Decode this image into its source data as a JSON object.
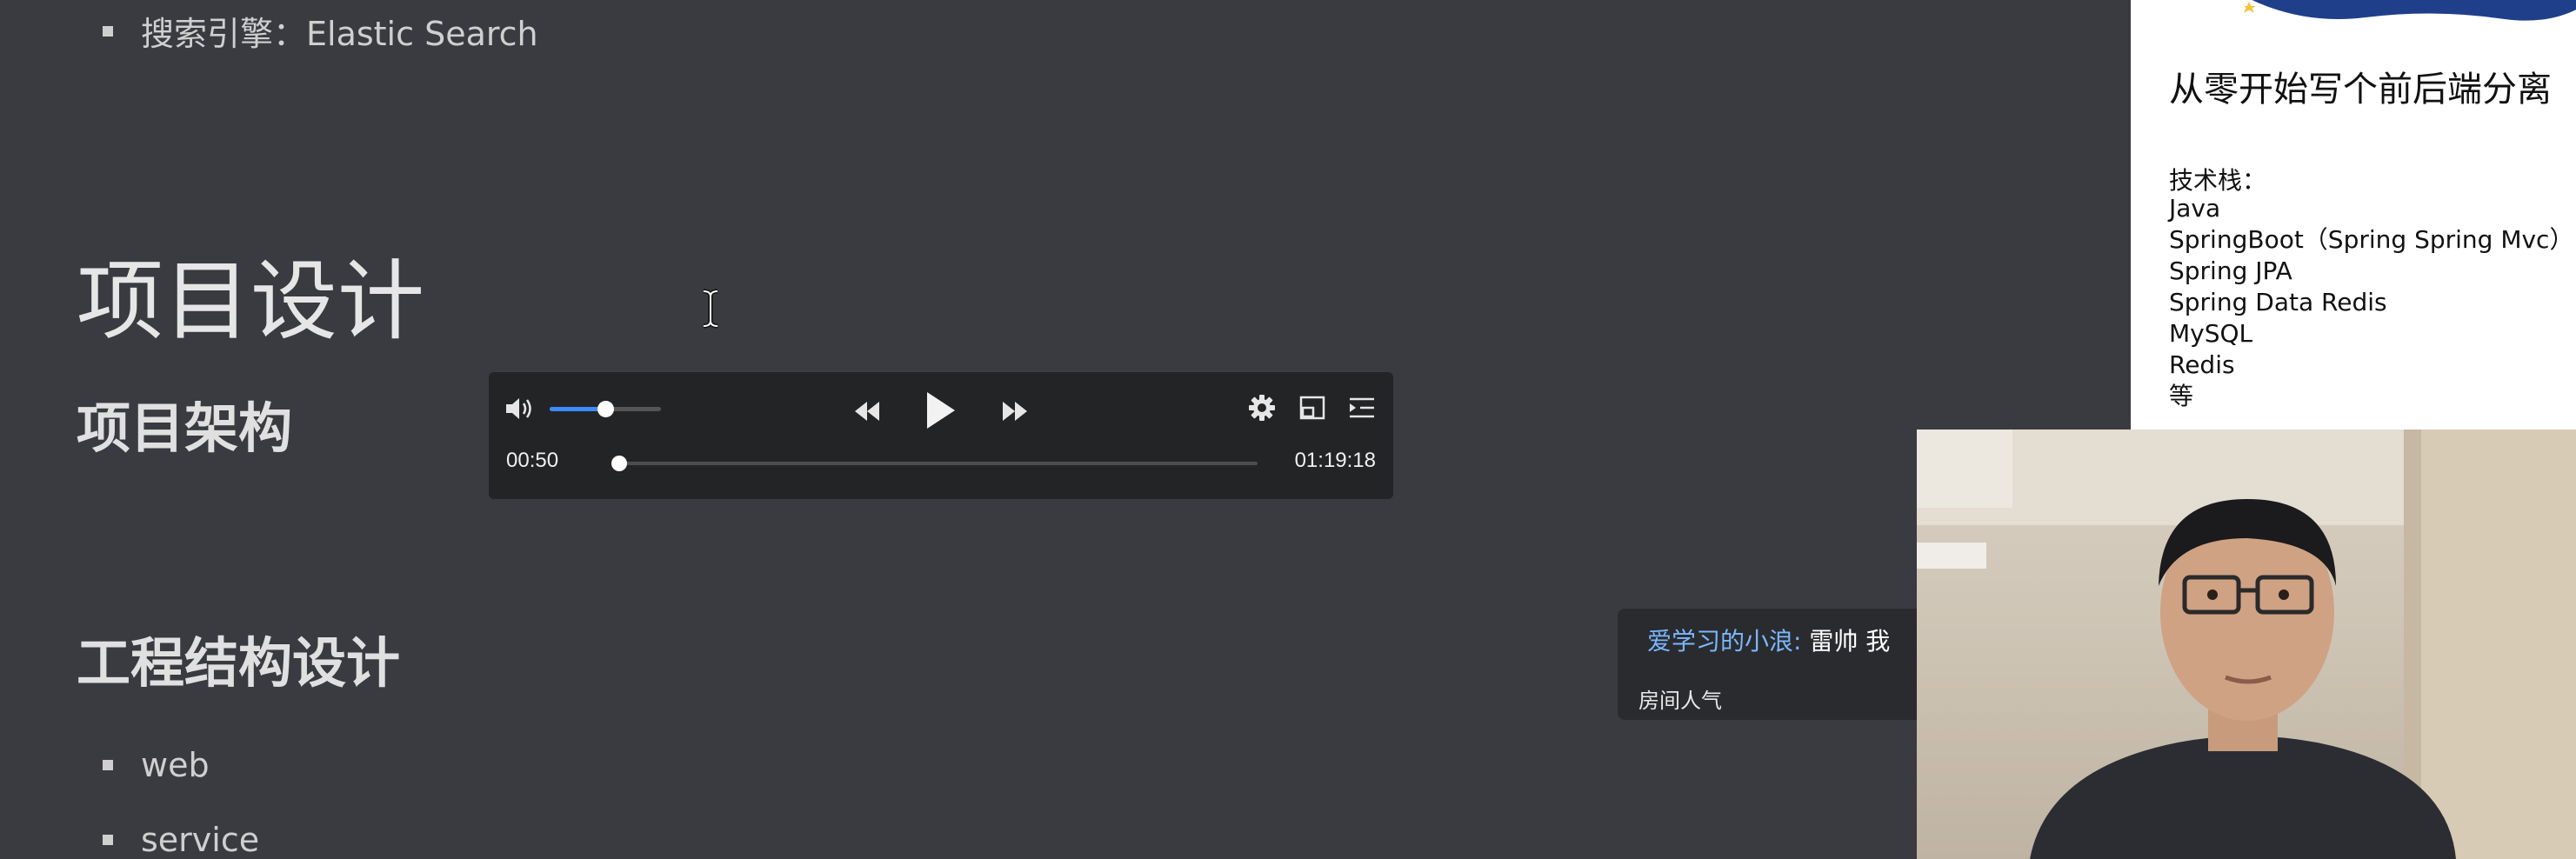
{
  "document": {
    "bullet_search": "搜索引擎：Elastic Search",
    "heading_project_design": "项目设计",
    "heading_architecture": "项目架构",
    "heading_structure": "工程结构设计",
    "bullets": [
      "web",
      "service"
    ]
  },
  "player": {
    "current_time": "00:50",
    "total_time": "01:19:18",
    "volume_fraction": 0.5,
    "progress_fraction": 0.011,
    "accent_color": "#3d8bff",
    "icons": [
      "volume-icon",
      "rewind-icon",
      "play-icon",
      "fast-forward-icon",
      "settings-icon",
      "picture-in-picture-icon",
      "playlist-icon"
    ]
  },
  "slide": {
    "title": "从零开始写个前后端分离",
    "stack_heading": "技术栈：",
    "stack_items": [
      "Java",
      "SpringBoot（Spring Spring Mvc）",
      "Spring JPA",
      "Spring Data Redis",
      "MySQL",
      "Redis",
      "等"
    ]
  },
  "chat": {
    "username": "爱学习的小浪:",
    "message": "雷帅 我",
    "popularity_label": "房间人气"
  }
}
